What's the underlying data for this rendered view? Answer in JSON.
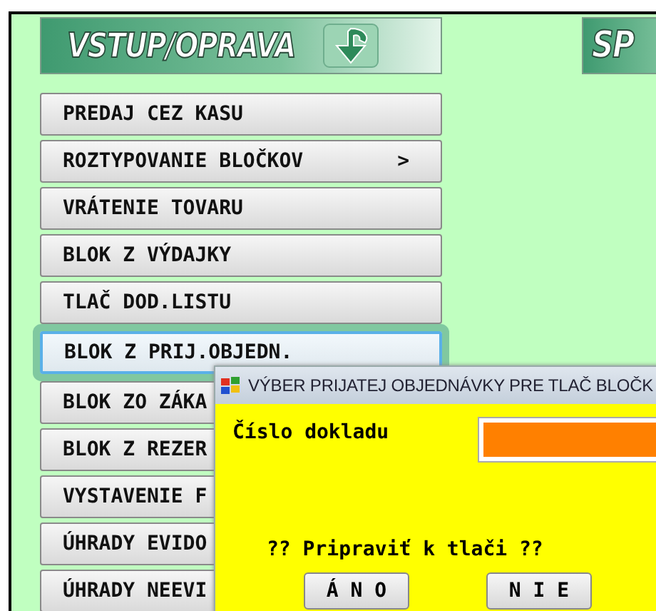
{
  "header": {
    "title": "VSTUP/OPRAVA",
    "right_title": "SP"
  },
  "menu": [
    {
      "label": "PREDAJ CEZ KASU",
      "selected": false
    },
    {
      "label": "ROZTYPOVANIE BLOČKOV",
      "submenu": ">",
      "selected": false
    },
    {
      "label": "VRÁTENIE TOVARU",
      "selected": false
    },
    {
      "label": "BLOK Z VÝDAJKY",
      "selected": false
    },
    {
      "label": "TLAČ DOD.LISTU",
      "selected": false
    },
    {
      "label": "BLOK Z PRIJ.OBJEDN.",
      "selected": true
    },
    {
      "label": "BLOK ZO ZÁKA",
      "selected": false
    },
    {
      "label": "BLOK Z REZER",
      "selected": false
    },
    {
      "label": "VYSTAVENIE F",
      "selected": false
    },
    {
      "label": "ÚHRADY EVIDO",
      "selected": false
    },
    {
      "label": "ÚHRADY NEEVI",
      "selected": false
    }
  ],
  "dialog": {
    "title": "VÝBER PRIJATEJ OBJEDNÁVKY PRE TLAČ BLOČK",
    "field_label": "Číslo dokladu",
    "question": "?? Pripraviť k tlači ??",
    "buttons": [
      "Á N O",
      "N I E"
    ]
  }
}
